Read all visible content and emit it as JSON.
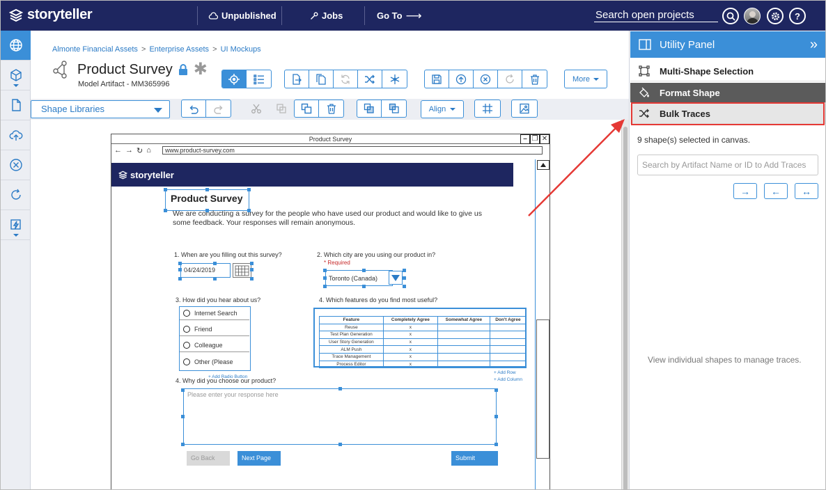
{
  "app": {
    "name": "storyteller"
  },
  "topbar": {
    "status": "Unpublished",
    "jobs": "Jobs",
    "goto": "Go To",
    "search_placeholder": "Search open projects",
    "help": "?"
  },
  "breadcrumb": [
    "Almonte Financial Assets",
    "Enterprise Assets",
    "UI Mockups"
  ],
  "artifact": {
    "title": "Product Survey",
    "subtitle": "Model Artifact - MM365996"
  },
  "toolbar": {
    "more_label": "More",
    "shape_libraries": "Shape Libraries",
    "align_label": "Align"
  },
  "mockup": {
    "window_title": "Product Survey",
    "url": "www.product-survey.com",
    "brand": "storyteller",
    "title": "Product Survey",
    "intro": "We are conducting a survey for the people who have used our product and would like to give us some feedback. Your responses will remain anonymous.",
    "q1": "1. When are you filling out this survey?",
    "q1_value": "04/24/2019",
    "q2": "2. Which city are you using our product in?",
    "q2_required": "* Required",
    "q2_value": "Toronto (Canada)",
    "q3": "3. How did you hear about us?",
    "q3_options": [
      "Internet Search",
      "Friend",
      "Colleague",
      "Other (Please"
    ],
    "q3_add": "+ Add Radio Button",
    "q4": "4. Which features do you find most useful?",
    "table_headers": [
      "Feature",
      "Completely Agree",
      "Somewhat Agree",
      "Don't Agree"
    ],
    "table_rows": [
      [
        "Reuse",
        "x",
        "",
        ""
      ],
      [
        "Test Plan Generation",
        "x",
        "",
        ""
      ],
      [
        "User Story Generation",
        "x",
        "",
        ""
      ],
      [
        "ALM Push",
        "x",
        "",
        ""
      ],
      [
        "Trace Management",
        "x",
        "",
        ""
      ],
      [
        "Process Editor",
        "x",
        "",
        ""
      ]
    ],
    "add_row": "+ Add Row",
    "add_column": "+ Add Column",
    "q5": "4. Why did you choose our product?",
    "q5_placeholder": "Please enter your response here",
    "go_back": "Go Back",
    "next_page": "Next Page",
    "submit": "Submit"
  },
  "utility_panel": {
    "title": "Utility Panel",
    "items": [
      "Multi-Shape Selection",
      "Format Shape",
      "Bulk Traces"
    ],
    "selected_text": "9 shape(s) selected in canvas.",
    "search_placeholder": "Search by Artifact Name or ID to Add Traces",
    "trace_buttons": [
      "→",
      "←",
      "↔"
    ],
    "empty_text": "View individual shapes to manage traces."
  },
  "colors": {
    "navy": "#1e2660",
    "accent": "#3b8fd8",
    "highlight": "#e53935"
  }
}
